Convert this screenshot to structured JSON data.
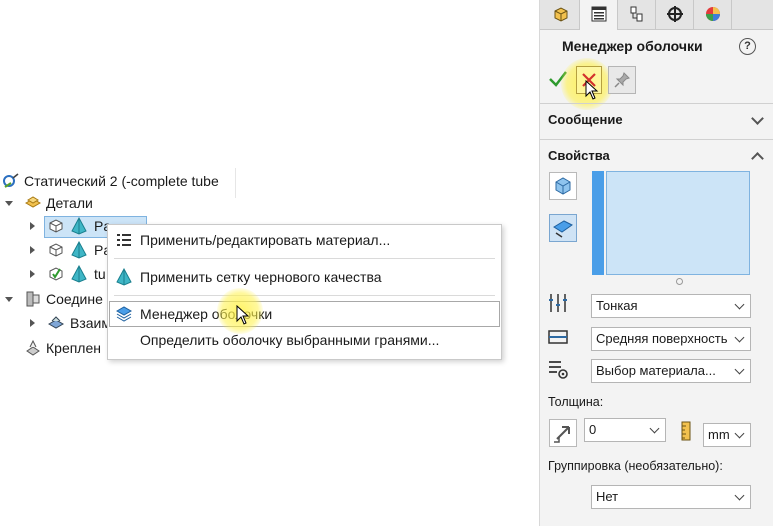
{
  "tree": {
    "root": "Статический 2 (-complete tube",
    "parts": "Детали",
    "items": [
      "Pa",
      "Pa",
      "tu"
    ],
    "connections": "Соедине",
    "interaction": "Взаим",
    "fixtures": "Креплен"
  },
  "context_menu": {
    "items": [
      {
        "label": "Применить/редактировать материал...",
        "icon": "material-list-icon"
      },
      {
        "label": "Применить сетку чернового качества",
        "icon": "mesh-icon"
      },
      {
        "label": "Менеджер оболочки",
        "icon": "shell-manager-icon"
      },
      {
        "label": "Определить оболочку выбранными гранями...",
        "icon": ""
      }
    ]
  },
  "panel": {
    "tabs": [
      "part-icon",
      "property-manager-icon",
      "configuration-icon",
      "crosshair-icon",
      "appearance-icon"
    ],
    "title": "Менеджер оболочки",
    "help": "?",
    "sections": {
      "message": "Сообщение",
      "properties": "Свойства"
    },
    "shell_type": "Тонкая",
    "offset": "Средняя поверхность",
    "material": "Выбор материала...",
    "thickness_label": "Толщина:",
    "thickness_value": "0",
    "unit": "mm",
    "group_label": "Группировка (необязательно):",
    "group_value": "Нет"
  },
  "colors": {
    "accent_blue": "#4a9ee8",
    "selection_fill": "#cce4f7",
    "ok_green": "#2e9a2e",
    "cancel_red": "#d2322d",
    "cursor_highlight": "#fff24a"
  }
}
